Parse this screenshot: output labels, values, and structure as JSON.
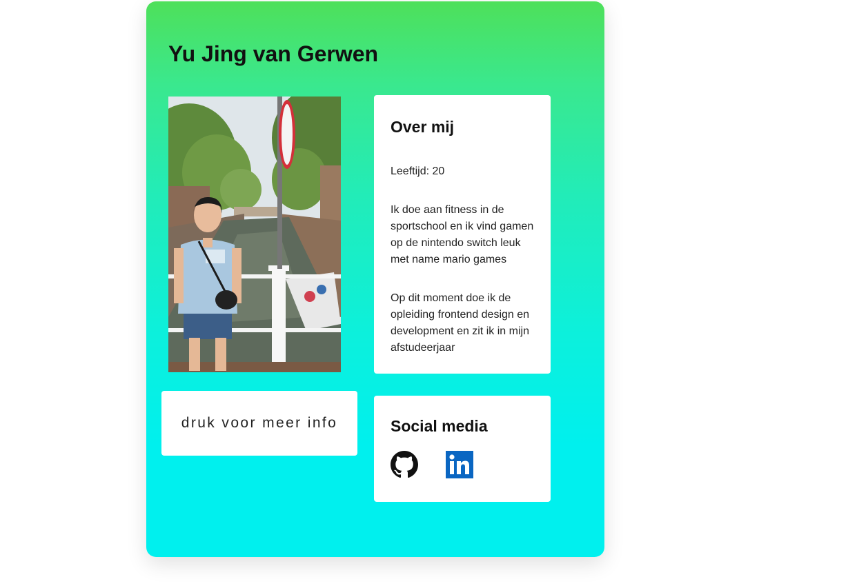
{
  "profile": {
    "name": "Yu Jing van Gerwen"
  },
  "button": {
    "more_info_label": "druk voor meer info"
  },
  "about": {
    "heading": "Over mij",
    "age": "Leeftijd: 20",
    "hobbies": "Ik doe aan fitness in de sportschool en ik vind gamen op de nintendo switch leuk met name mario games",
    "study": "Op dit moment doe ik de opleiding frontend design en development en zit ik in mijn afstudeerjaar"
  },
  "social": {
    "heading": "Social media",
    "links": [
      {
        "icon": "github-icon"
      },
      {
        "icon": "linkedin-icon"
      }
    ]
  },
  "colors": {
    "gradient_top": "#4ee05a",
    "gradient_bottom": "#00f0ee",
    "linkedin_blue": "#0a66c2"
  }
}
